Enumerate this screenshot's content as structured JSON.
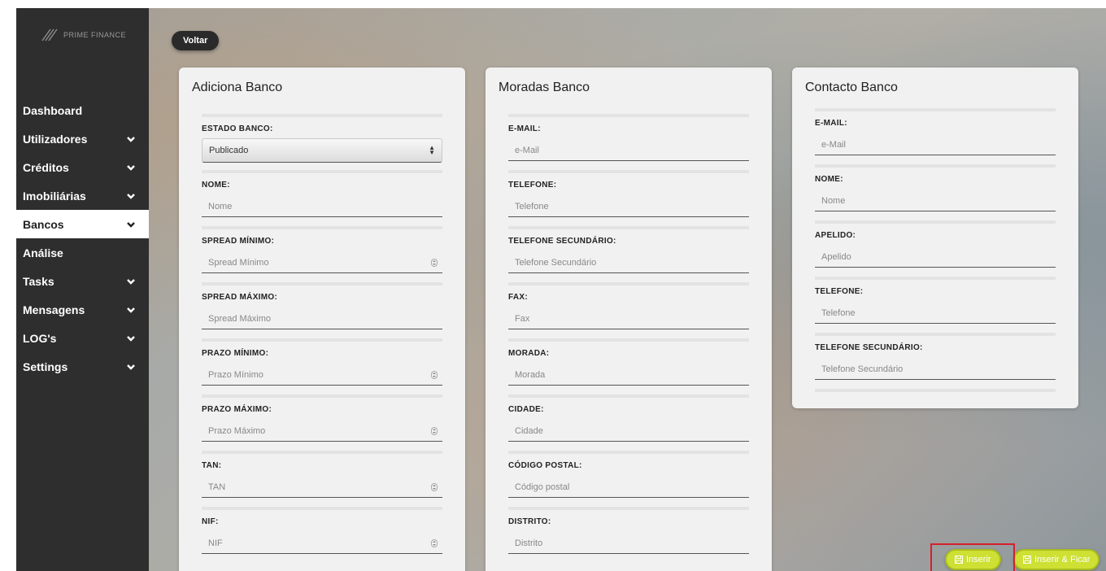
{
  "brand": {
    "name": "PRIME FINANCE"
  },
  "sidebar": {
    "items": [
      {
        "label": "Dashboard",
        "chevron": false,
        "active": false
      },
      {
        "label": "Utilizadores",
        "chevron": true,
        "active": false
      },
      {
        "label": "Créditos",
        "chevron": true,
        "active": false
      },
      {
        "label": "Imobiliárias",
        "chevron": true,
        "active": false
      },
      {
        "label": "Bancos",
        "chevron": true,
        "active": true
      },
      {
        "label": "Análise",
        "chevron": false,
        "active": false
      },
      {
        "label": "Tasks",
        "chevron": true,
        "active": false
      },
      {
        "label": "Mensagens",
        "chevron": true,
        "active": false
      },
      {
        "label": "LOG's",
        "chevron": true,
        "active": false
      },
      {
        "label": "Settings",
        "chevron": true,
        "active": false
      }
    ]
  },
  "toolbar": {
    "back_label": "Voltar"
  },
  "cards": {
    "banco": {
      "title": "Adiciona Banco",
      "estado": {
        "label": "ESTADO BANCO:",
        "value": "Publicado"
      },
      "fields": [
        {
          "label": "NOME:",
          "placeholder": "Nome",
          "number": false
        },
        {
          "label": "SPREAD MÍNIMO:",
          "placeholder": "Spread Mínimo",
          "number": true
        },
        {
          "label": "SPREAD MÁXIMO:",
          "placeholder": "Spread Máximo",
          "number": false
        },
        {
          "label": "PRAZO MÍNIMO:",
          "placeholder": "Prazo Mínimo",
          "number": true
        },
        {
          "label": "PRAZO MÁXIMO:",
          "placeholder": "Prazo Máximo",
          "number": true
        },
        {
          "label": "TAN:",
          "placeholder": "TAN",
          "number": true
        },
        {
          "label": "NIF:",
          "placeholder": "NIF",
          "number": true
        }
      ]
    },
    "moradas": {
      "title": "Moradas Banco",
      "fields": [
        {
          "label": "E-MAIL:",
          "placeholder": "e-Mail"
        },
        {
          "label": "TELEFONE:",
          "placeholder": "Telefone"
        },
        {
          "label": "TELEFONE SECUNDÁRIO:",
          "placeholder": "Telefone Secundário"
        },
        {
          "label": "FAX:",
          "placeholder": "Fax"
        },
        {
          "label": "MORADA:",
          "placeholder": "Morada"
        },
        {
          "label": "CIDADE:",
          "placeholder": "Cidade"
        },
        {
          "label": "CÓDIGO POSTAL:",
          "placeholder": "Código postal"
        },
        {
          "label": "DISTRITO:",
          "placeholder": "Distrito"
        }
      ]
    },
    "contacto": {
      "title": "Contacto Banco",
      "fields": [
        {
          "label": "E-MAIL:",
          "placeholder": "e-Mail"
        },
        {
          "label": "NOME:",
          "placeholder": "Nome"
        },
        {
          "label": "APELIDO:",
          "placeholder": "Apelido"
        },
        {
          "label": "TELEFONE:",
          "placeholder": "Telefone"
        },
        {
          "label": "TELEFONE SECUNDÁRIO:",
          "placeholder": "Telefone Secundário"
        }
      ]
    }
  },
  "actions": {
    "insert_label": "Inserir",
    "insert_stay_label": "Inserir & Ficar"
  },
  "colors": {
    "accent": "#cde033",
    "sidebar": "#2e2e2e",
    "highlight": "#d5202a"
  }
}
